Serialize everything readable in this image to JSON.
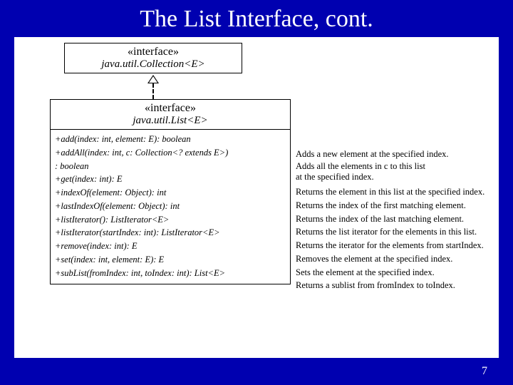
{
  "title": "The List Interface, cont.",
  "page_number": "7",
  "parent_box": {
    "stereotype": "«interface»",
    "name": "java.util.Collection<E>"
  },
  "main_box": {
    "stereotype": "«interface»",
    "name": "java.util.List<E>"
  },
  "methods": [
    "+add(index: int, element: E): boolean",
    "+addAll(index: int, c: Collection<? extends E>)",
    "  : boolean",
    "+get(index: int): E",
    "+indexOf(element: Object): int",
    "+lastIndexOf(element: Object): int",
    "+listIterator(): ListIterator<E>",
    "+listIterator(startIndex: int): ListIterator<E>",
    "+remove(index: int): E",
    "+set(index: int, element: E): E",
    "+subList(fromIndex: int, toIndex: int): List<E>"
  ],
  "descriptions": [
    {
      "text": "Adds a new element at the specified index.",
      "rows": 1
    },
    {
      "text": "Adds all the elements in c to this list at the specified index.",
      "rows": 2
    },
    {
      "text": "Returns the element in this list at the specified index.",
      "rows": 1
    },
    {
      "text": "Returns the index of the first matching element.",
      "rows": 1
    },
    {
      "text": "Returns the index of the last matching element.",
      "rows": 1
    },
    {
      "text": "Returns the list iterator for the elements in this list.",
      "rows": 1
    },
    {
      "text": "Returns the iterator for the elements from startIndex.",
      "rows": 1
    },
    {
      "text": "Removes the element at the specified index.",
      "rows": 1
    },
    {
      "text": "Sets the element at the specified index.",
      "rows": 1
    },
    {
      "text": "Returns a sublist from fromIndex to toIndex.",
      "rows": 1
    }
  ]
}
